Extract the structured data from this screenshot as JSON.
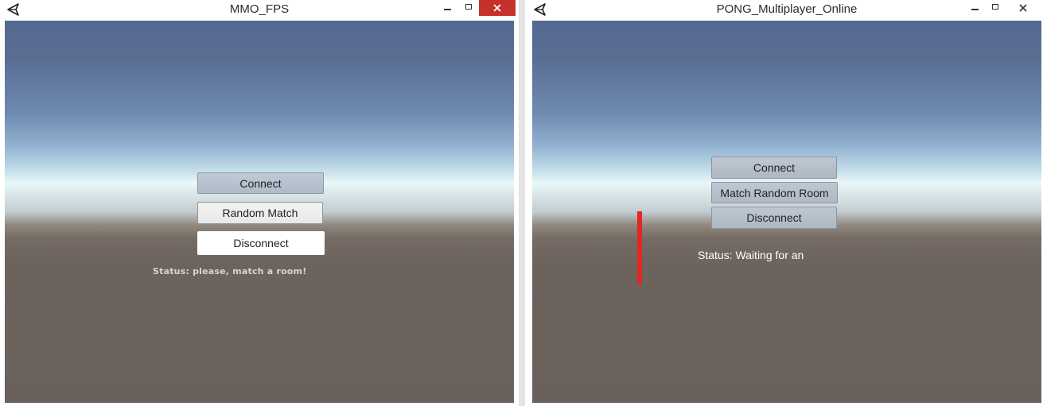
{
  "windows": [
    {
      "title": "MMO_FPS",
      "buttons": {
        "connect": "Connect",
        "random_match": "Random Match",
        "disconnect": "Disconnect"
      },
      "status": "Status: please, match a room!"
    },
    {
      "title": "PONG_Multiplayer_Online",
      "buttons": {
        "connect": "Connect",
        "match_random_room": "Match Random Room",
        "disconnect": "Disconnect"
      },
      "status": "Status: Waiting for an"
    }
  ],
  "colors": {
    "close_button_active": "#c7312b",
    "paddle": "#e42626",
    "ground": "#6a615c",
    "sky_top": "#54698f"
  },
  "icons": [
    "unity-logo-icon",
    "minimize-icon",
    "maximize-icon",
    "close-icon"
  ]
}
